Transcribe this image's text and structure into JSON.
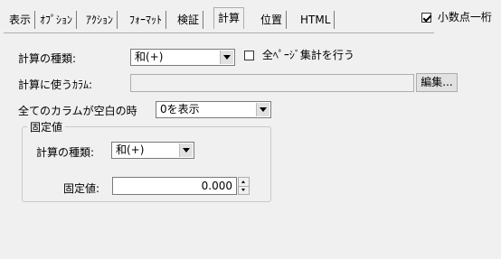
{
  "tabs": [
    {
      "label": "表示"
    },
    {
      "label": "ｵﾌﾟｼｮﾝ"
    },
    {
      "label": "ｱｸｼｮﾝ"
    },
    {
      "label": "ﾌｫｰﾏｯﾄ"
    },
    {
      "label": "検証"
    },
    {
      "label": "計算",
      "active": true
    },
    {
      "label": "位置"
    },
    {
      "label": "HTML"
    }
  ],
  "decimal_point": {
    "label": "小数点一桁",
    "checked": true
  },
  "calc_type": {
    "label": "計算の種類:",
    "value": "和(+)"
  },
  "all_pages": {
    "label": "全ﾍﾟｰｼﾞ集計を行う",
    "checked": false
  },
  "calc_columns": {
    "label": "計算に使うｶﾗﾑ:",
    "value": "",
    "edit_button": "編集..."
  },
  "all_empty": {
    "label": "全てのカラムが空白の時",
    "value": "0を表示"
  },
  "fixed_group": {
    "title": "固定値",
    "calc_type_label": "計算の種類:",
    "calc_type_value": "和(+)",
    "fixed_label": "固定値:",
    "fixed_value": "0.000"
  }
}
